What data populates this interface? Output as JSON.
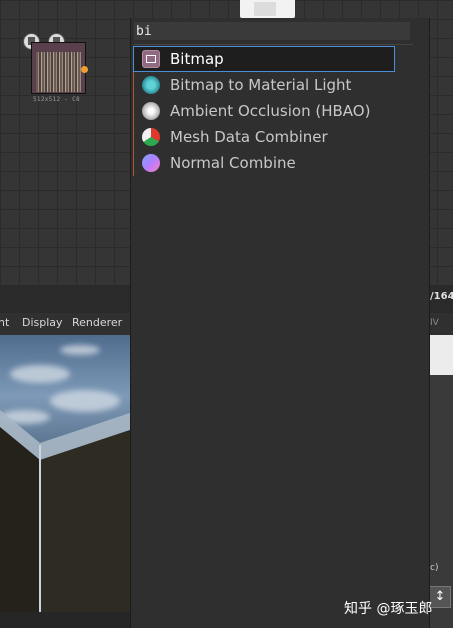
{
  "graph": {
    "bitmap_node_caption": "512x512 - C8"
  },
  "viewer": {
    "toolbar": [
      "nt",
      "Display",
      "Renderer"
    ]
  },
  "right_panel": {
    "header": "/164",
    "sub": "IV",
    "small_text": "c)",
    "button_glyph": "↕"
  },
  "search": {
    "value": "bi",
    "results": [
      {
        "label": "Bitmap",
        "icon": "bitmap-icon",
        "selected": true
      },
      {
        "label": "Bitmap to Material Light",
        "icon": "material-light-icon",
        "selected": false
      },
      {
        "label": "Ambient Occlusion (HBAO)",
        "icon": "ambient-occlusion-icon",
        "selected": false
      },
      {
        "label": "Mesh Data Combiner",
        "icon": "mesh-data-combiner-icon",
        "selected": false
      },
      {
        "label": "Normal Combine",
        "icon": "normal-combine-icon",
        "selected": false
      }
    ]
  },
  "watermark": "知乎 @琢玉郎",
  "colors": {
    "selection_border": "#4a8fd8",
    "result_accent": "#b5563c",
    "port": "#f0a030"
  }
}
